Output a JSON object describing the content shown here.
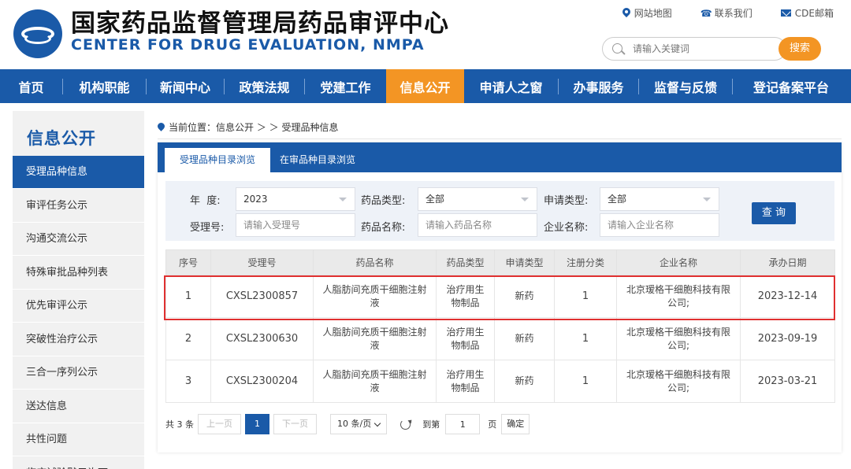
{
  "header": {
    "title": "国家药品监督管理局药品审评中心",
    "subtitle": "CENTER FOR DRUG EVALUATION, NMPA",
    "top_links": [
      "网站地图",
      "联系我们",
      "CDE邮箱"
    ],
    "search_placeholder": "请输入关键词",
    "search_button": "搜索"
  },
  "nav": {
    "items": [
      "首页",
      "机构职能",
      "新闻中心",
      "政策法规",
      "党建工作",
      "信息公开",
      "申请人之窗",
      "办事服务",
      "监督与反馈",
      "登记备案平台"
    ],
    "active": "信息公开"
  },
  "sidebar": {
    "title": "信息公开",
    "items": [
      "受理品种信息",
      "审评任务公示",
      "沟通交流公示",
      "特殊审批品种列表",
      "优先审评公示",
      "突破性治疗公示",
      "三合一序列公示",
      "送达信息",
      "共性问题",
      "临床试验默示许可"
    ]
  },
  "breadcrumb": "当前位置：信息公开 ＞ ＞ 受理品种信息",
  "tabs": [
    "受理品种目录浏览",
    "在审品种目录浏览"
  ],
  "filters": {
    "year_label": "年  度:",
    "year_value": "2023",
    "drug_type_label": "药品类型:",
    "drug_type_value": "全部",
    "apply_type_label": "申请类型:",
    "apply_type_value": "全部",
    "accept_no_label": "受理号:",
    "accept_no_placeholder": "请输入受理号",
    "drug_name_label": "药品名称:",
    "drug_name_placeholder": "请输入药品名称",
    "company_label": "企业名称:",
    "company_placeholder": "请输入企业名称",
    "query_button": "查 询"
  },
  "table": {
    "headers": [
      "序号",
      "受理号",
      "药品名称",
      "药品类型",
      "申请类型",
      "注册分类",
      "企业名称",
      "承办日期"
    ],
    "rows": [
      [
        "1",
        "CXSL2300857",
        "人脂肪间充质干细胞注射液",
        "治疗用生物制品",
        "新药",
        "1",
        "北京瑷格干细胞科技有限公司;",
        "2023-12-14"
      ],
      [
        "2",
        "CXSL2300630",
        "人脂肪间充质干细胞注射液",
        "治疗用生物制品",
        "新药",
        "1",
        "北京瑷格干细胞科技有限公司;",
        "2023-09-19"
      ],
      [
        "3",
        "CXSL2300204",
        "人脂肪间充质干细胞注射液",
        "治疗用生物制品",
        "新药",
        "1",
        "北京瑷格干细胞科技有限公司;",
        "2023-03-21"
      ]
    ]
  },
  "pagination": {
    "total": "共 3 条",
    "prev": "上一页",
    "current": "1",
    "next": "下一页",
    "page_size": "10 条/页",
    "goto_label": "到第",
    "goto_value": "1",
    "page_unit": "页",
    "confirm": "确定"
  },
  "colors": {
    "primary": "#1a5aa8",
    "accent": "#f39524",
    "highlight": "#e03030"
  }
}
